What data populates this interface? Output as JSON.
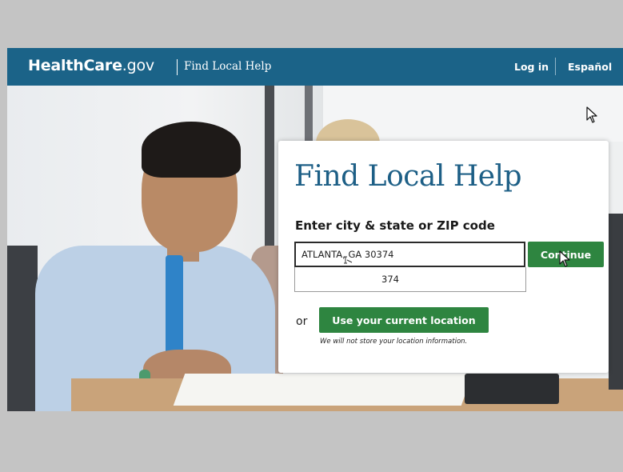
{
  "header": {
    "logo_main": "HealthCare",
    "logo_suffix": ".gov",
    "title": "Find Local Help",
    "nav": {
      "login": "Log in",
      "espanol": "Español"
    },
    "bg_color": "#1b6388"
  },
  "card": {
    "title": "Find Local Help",
    "label": "Enter city & state or ZIP code",
    "input_value": "ATLANTA, GA 30374",
    "suggestion": "374",
    "continue_label": "Continue",
    "or_text": "or",
    "location_button_label": "Use your current location",
    "disclaimer": "We will not store your location information.",
    "title_color": "#1d5f86",
    "button_color": "#2e8540"
  },
  "icons": {
    "pointer": "arrow-cursor-icon",
    "hand": "hand-cursor-icon"
  }
}
